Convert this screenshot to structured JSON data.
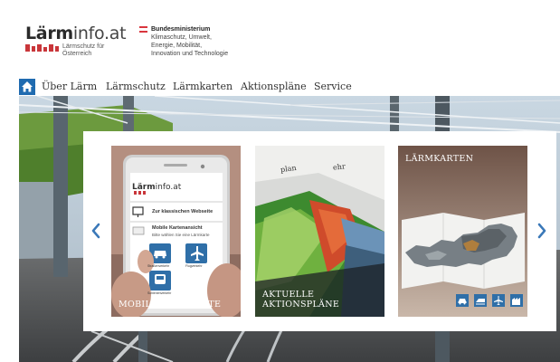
{
  "brand": {
    "word_bold": "Lärm",
    "word_light": "info.at",
    "subtitle_line1": "Lärmschutz für",
    "subtitle_line2": "Österreich"
  },
  "ministry": {
    "title": "Bundesministerium",
    "lines": [
      "Klimaschutz, Umwelt,",
      "Energie, Mobilität,",
      "Innovation und Technologie"
    ]
  },
  "nav": {
    "home_icon": "home-icon",
    "items": [
      "Über Lärm",
      "Lärmschutz",
      "Lärmkarten",
      "Aktionspläne",
      "Service"
    ]
  },
  "carousel": {
    "cards": [
      {
        "label": "MOBILE LÄRMKARTE",
        "phone": {
          "brand_bold": "Lärm",
          "brand_light": "info.at",
          "title": "Mobile Kartenansicht",
          "subtitle": "Bitte wählen Sie eine Lärmkarte",
          "classic_link": "Zur klassischen Webseite",
          "tiles": [
            "Straßenverkehr",
            "Flugverkehr",
            "Schienenverkehr"
          ]
        }
      },
      {
        "label_line1": "AKTUELLE",
        "label_line2": "AKTIONSPLÄNE",
        "doc_words": [
          "plan",
          "ehr"
        ]
      },
      {
        "title": "LÄRMKARTEN",
        "icons": [
          "car-icon",
          "train-icon",
          "plane-icon",
          "factory-icon"
        ]
      }
    ],
    "prev_icon": "chevron-left-icon",
    "next_icon": "chevron-right-icon"
  },
  "colors": {
    "brand_red": "#c9363a",
    "nav_blue": "#1f6bb0",
    "arrow_blue": "#3a78b8",
    "icon_blue": "#2f6fa8"
  }
}
